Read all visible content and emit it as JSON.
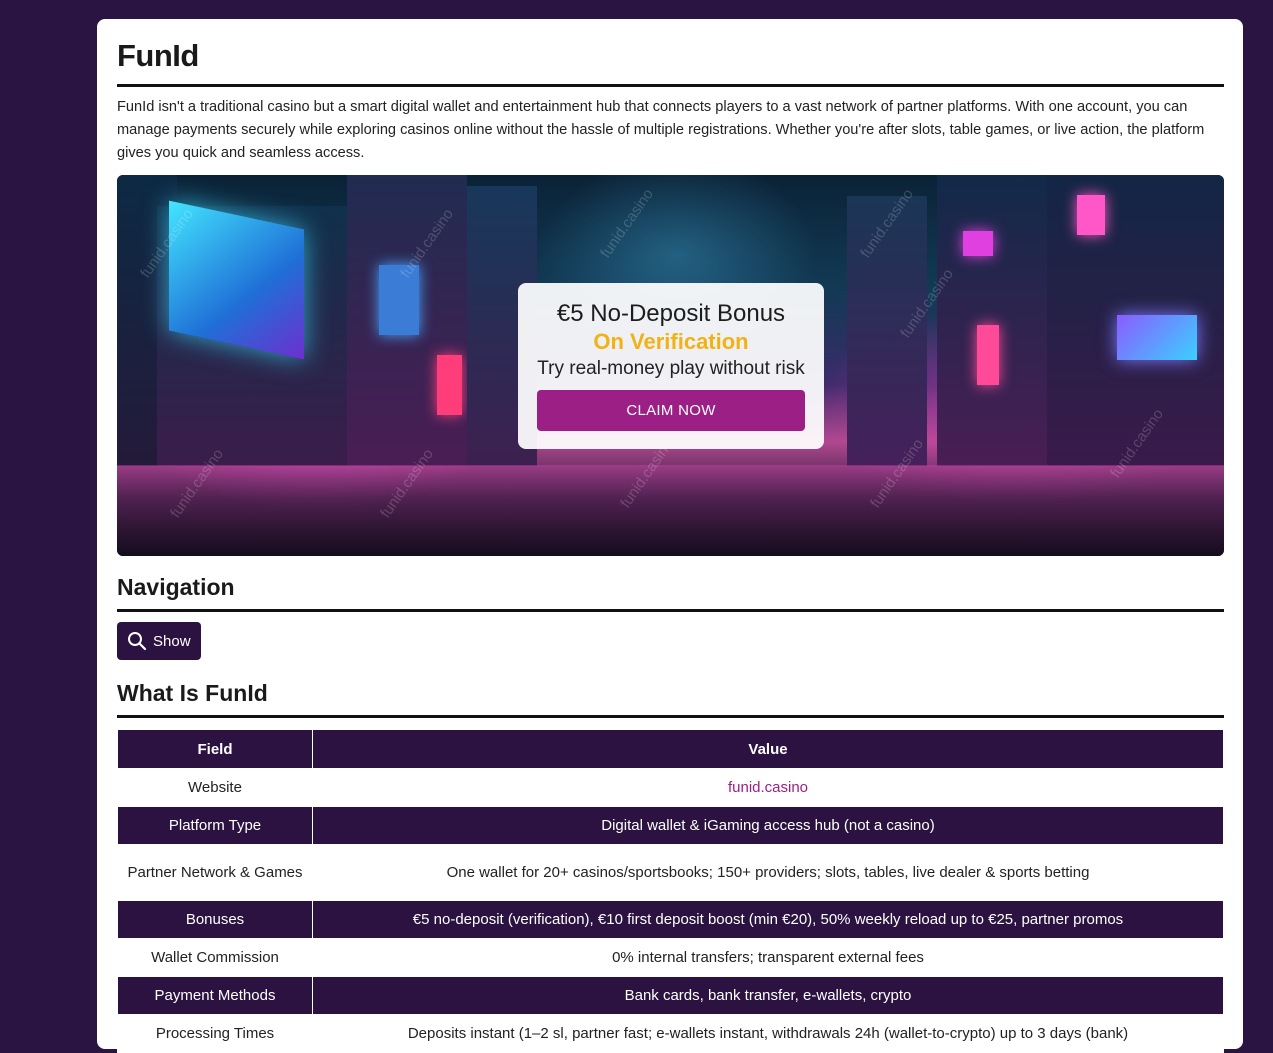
{
  "page": {
    "title": "FunId",
    "intro": "FunId isn't a traditional casino but a smart digital wallet and entertainment hub that connects players to a vast network of partner platforms. With one account, you can manage payments securely while exploring casinos online without the hassle of multiple registrations. Whether you're after slots, table games, or live action, the platform gives you quick and seamless access."
  },
  "banner": {
    "watermark": "funid.casino",
    "promo_title": "€5 No-Deposit Bonus",
    "promo_subtitle": "On Verification",
    "promo_desc": "Try real-money play without risk",
    "cta_label": "CLAIM NOW"
  },
  "navigation": {
    "heading": "Navigation",
    "show_label": "Show",
    "show_icon": "search-icon"
  },
  "what_is": {
    "heading": "What Is FunId",
    "columns": [
      "Field",
      "Value"
    ],
    "rows": [
      {
        "field": "Website",
        "value": "funid.casino"
      },
      {
        "field": "Platform Type",
        "value": "Digital wallet & iGaming access hub (not a casino)"
      },
      {
        "field": "Partner Network & Games",
        "value": "One wallet for 20+ casinos/sportsbooks; 150+ providers; slots, tables, live dealer & sports betting"
      },
      {
        "field": "Bonuses",
        "value": "€5 no-deposit (verification), €10 first deposit boost (min €20), 50% weekly reload up to €25, partner promos"
      },
      {
        "field": "Wallet Commission",
        "value": "0% internal transfers; transparent external fees"
      },
      {
        "field": "Payment Methods",
        "value": "Bank cards, bank transfer, e-wallets, crypto"
      },
      {
        "field": "Processing Times",
        "value": "Deposits instant (1–2 sl, partner fast; e-wallets instant, withdrawals 24h (wallet-to-crypto) up to 3 days (bank)"
      }
    ]
  },
  "colors": {
    "background": "#2a1442",
    "accent": "#9c1f86",
    "highlight": "#f1b215",
    "table_dark": "#2b1240"
  }
}
